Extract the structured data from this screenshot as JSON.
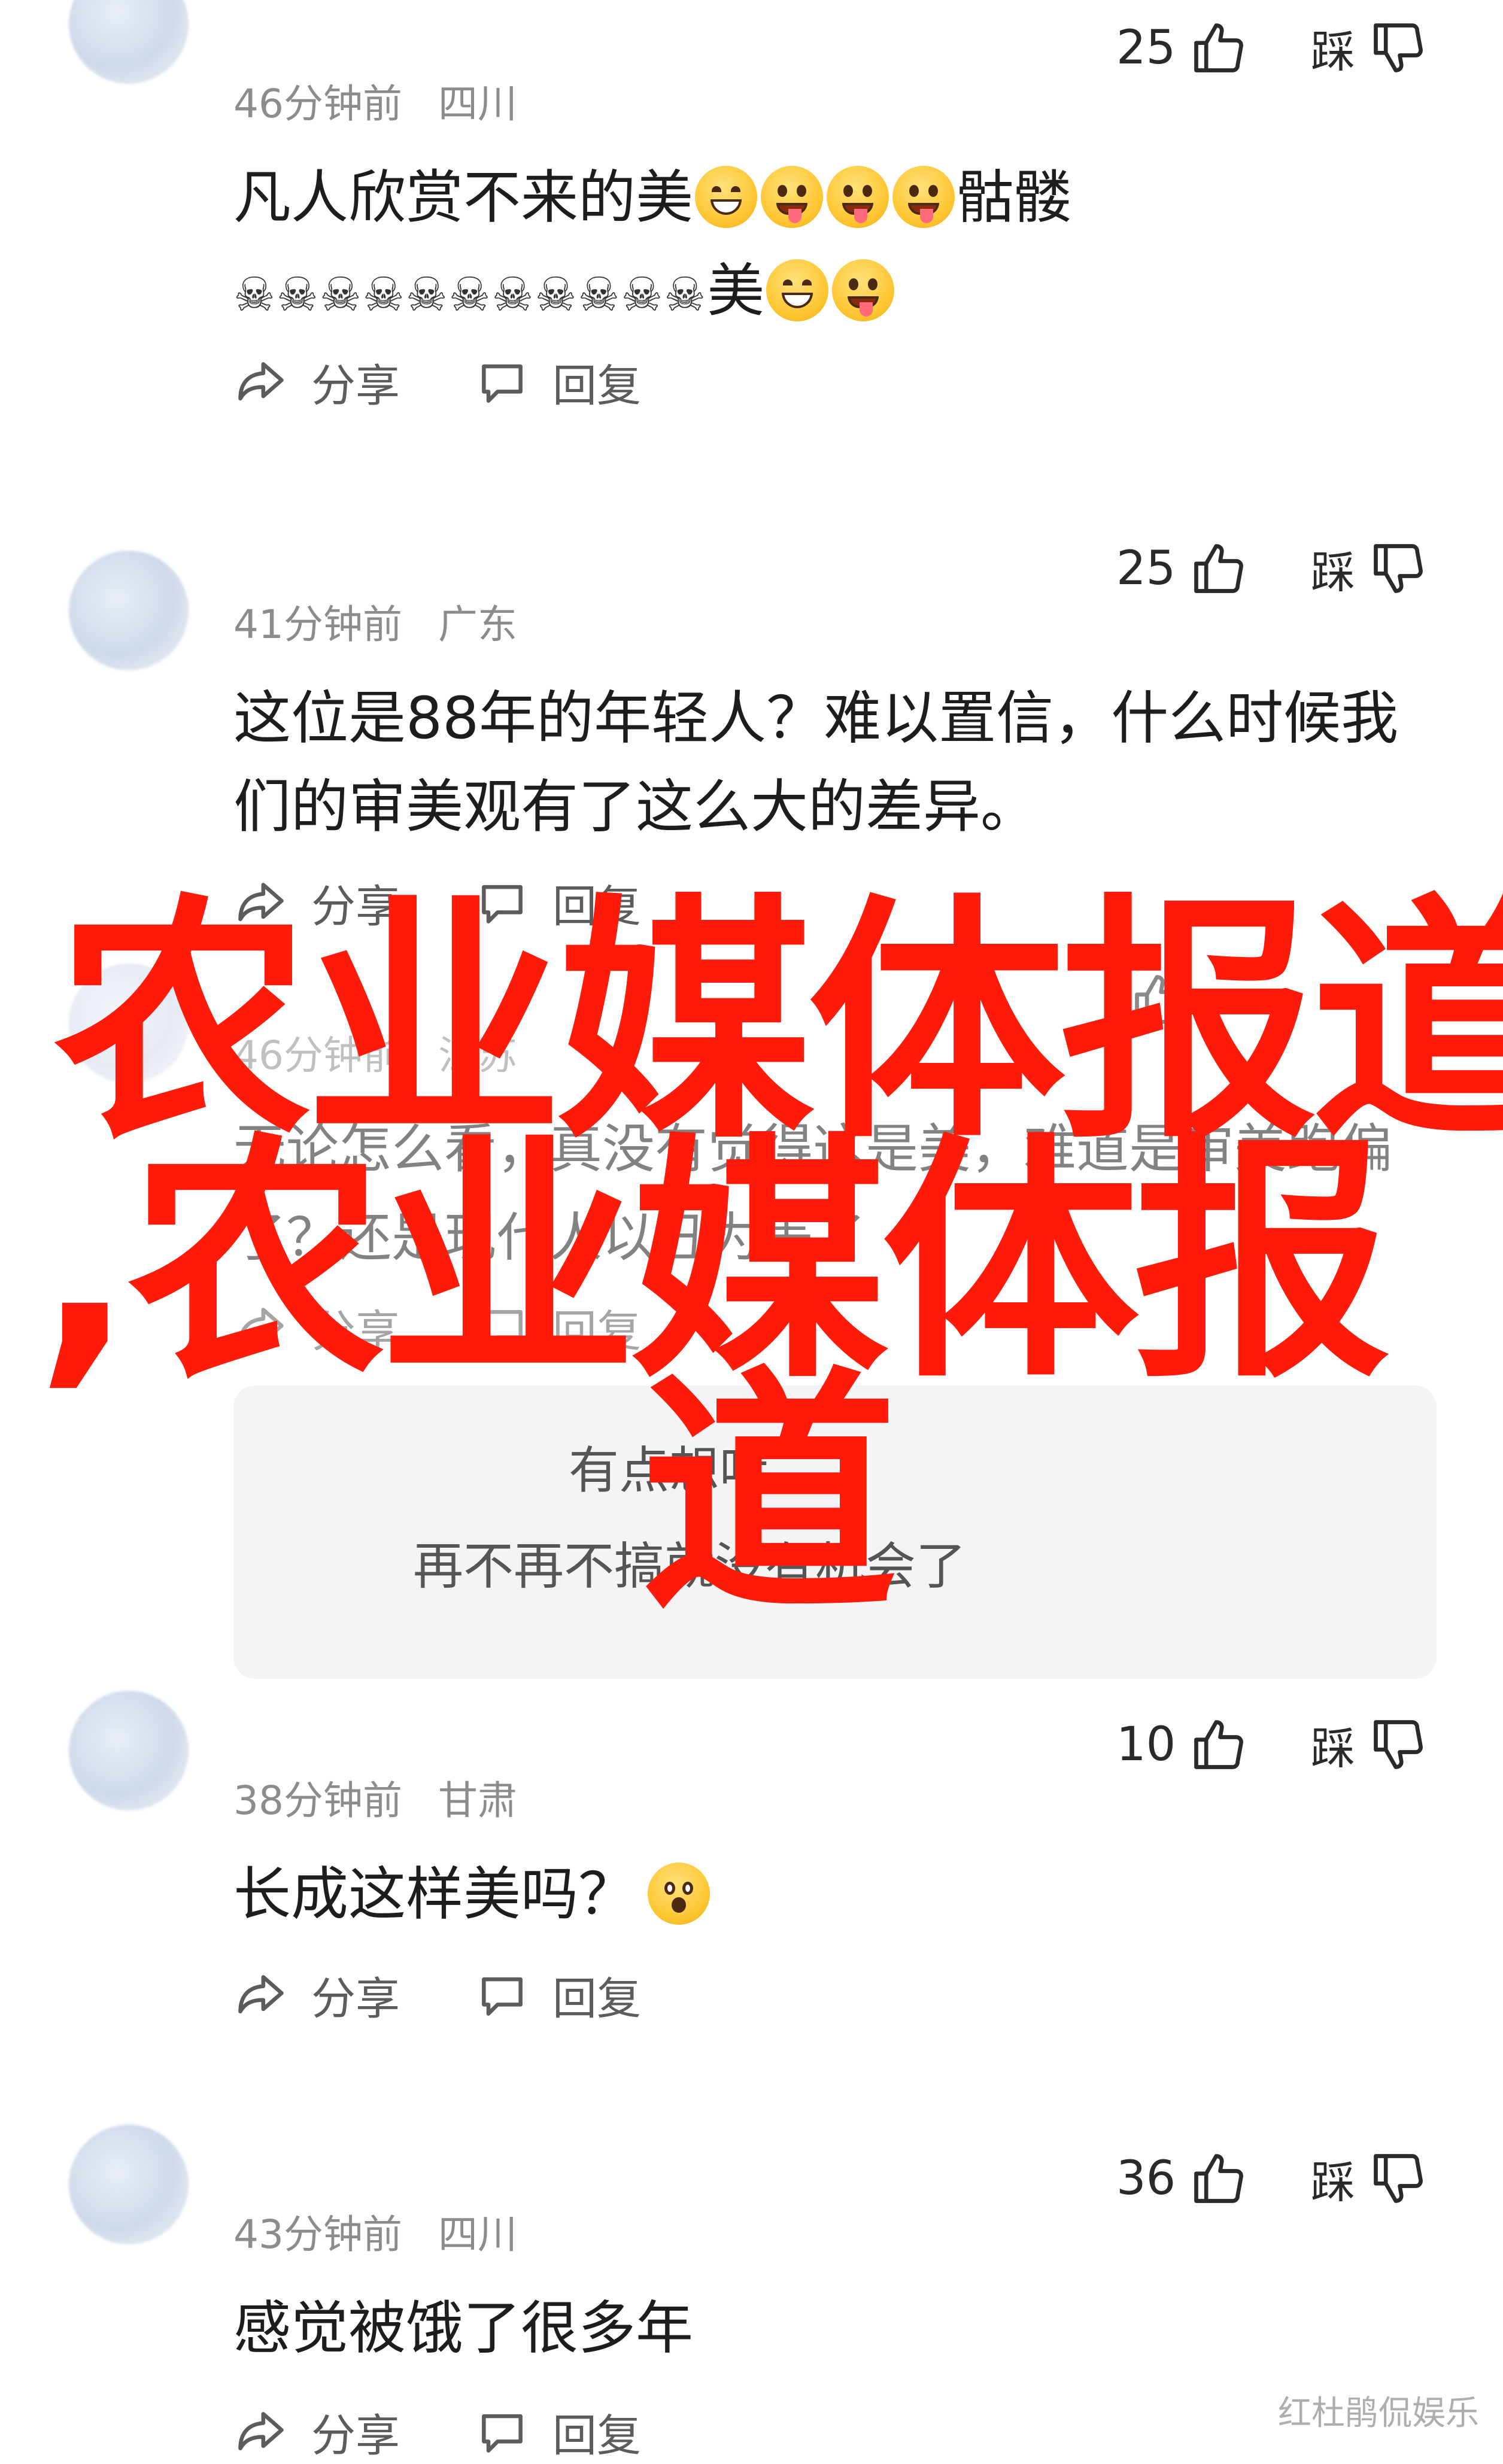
{
  "labels": {
    "share": "分享",
    "reply": "回复",
    "dislike": "踩"
  },
  "comments": [
    {
      "username": "",
      "time": "46分钟前",
      "location": "四川",
      "likes": "25",
      "text_line1": "凡人欣赏不来的美",
      "text_line1_tail": "骷髅",
      "text_line2_skulls": "☠☠☠☠☠☠☠☠☠☠☠",
      "text_line2_tail": "美"
    },
    {
      "username": "",
      "time": "41分钟前",
      "location": "广东",
      "likes": "25",
      "text": "这位是88年的年轻人？难以置信，什么时候我们的审美观有了这么大的差异。"
    },
    {
      "username": "",
      "time": "46分钟前",
      "location": "江苏",
      "likes": "",
      "text": "无论怎么看，真没有觉得这是美，难道是审美跑偏了？还是现代人以丑为美了"
    },
    {
      "username": "",
      "time": "38分钟前",
      "location": "甘肃",
      "likes": "10",
      "text": "长成这样美吗？"
    },
    {
      "username": "",
      "time": "43分钟前",
      "location": "四川",
      "likes": "36",
      "text": "感觉被饿了很多年"
    }
  ],
  "replies": [
    {
      "text": "有点想吐"
    },
    {
      "text": "再不再不搞就没有机会了"
    }
  ],
  "watermark": {
    "line1": "农业媒体报道",
    "line2": ",农业媒体报",
    "line3": "道"
  },
  "corner_mark": "红杜鹃侃娱乐",
  "colors": {
    "watermark": "#ff1a0a",
    "meta": "#8c8c8c",
    "background": "#ffffff"
  }
}
